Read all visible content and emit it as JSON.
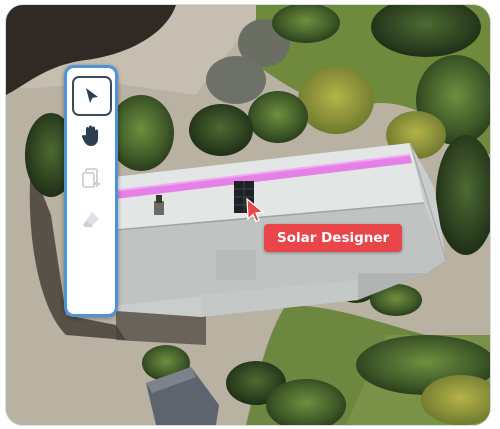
{
  "map": {
    "selection_line_color": "#e36ee6",
    "roof_color": "#dfe4e2"
  },
  "toolbar": {
    "accent_color": "#4f93d6",
    "tools": [
      {
        "icon": "select-arrow-icon",
        "active": true
      },
      {
        "icon": "hand-pan-icon",
        "active": false
      },
      {
        "icon": "add-layer-icon",
        "active": false,
        "disabled": true
      },
      {
        "icon": "eraser-icon",
        "active": false,
        "disabled": true
      }
    ]
  },
  "tooltip": {
    "label": "Solar Designer",
    "color": "#e8464b"
  },
  "cursor": {
    "icon": "cursor-arrow-icon",
    "color": "#e8464b"
  }
}
